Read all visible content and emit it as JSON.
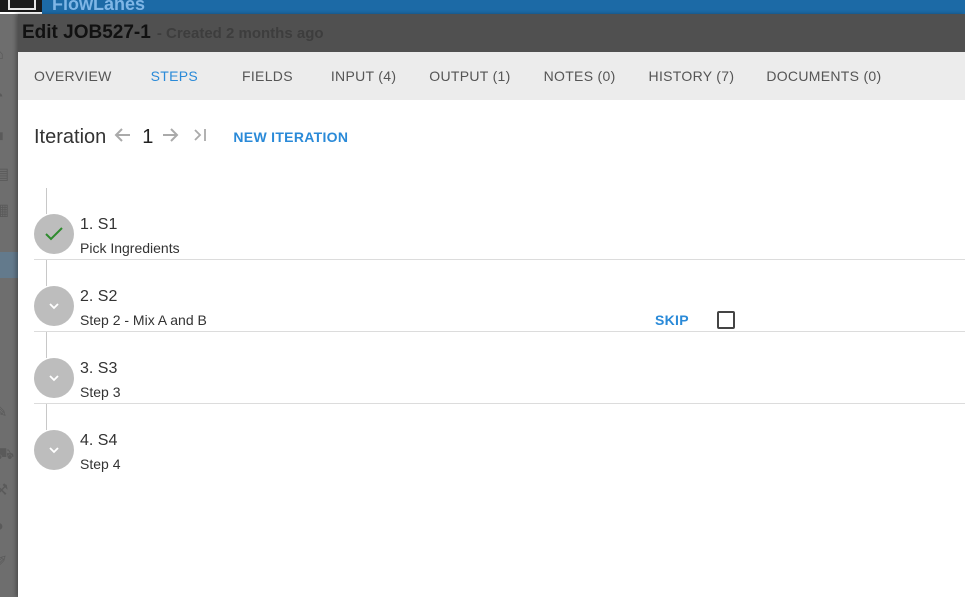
{
  "app": {
    "title": "FlowLanes"
  },
  "dialog": {
    "title": "Edit JOB527-1",
    "subtitle": "- Created 2 months ago"
  },
  "tabs": [
    {
      "label": "OVERVIEW",
      "active": false
    },
    {
      "label": "STEPS",
      "active": true
    },
    {
      "label": "FIELDS",
      "active": false
    },
    {
      "label": "INPUT (4)",
      "active": false
    },
    {
      "label": "OUTPUT (1)",
      "active": false
    },
    {
      "label": "NOTES (0)",
      "active": false
    },
    {
      "label": "HISTORY (7)",
      "active": false
    },
    {
      "label": "DOCUMENTS (0)",
      "active": false
    }
  ],
  "iteration": {
    "label": "Iteration",
    "prev_icon": "arrow-left-icon",
    "current": "1",
    "next_icon": "arrow-right-icon",
    "last_icon": "skip-to-last-icon",
    "new_label": "NEW ITERATION"
  },
  "steps": [
    {
      "title": "1. S1",
      "description": "Pick Ingredients",
      "status": "complete",
      "icon": "check-icon"
    },
    {
      "title": "2. S2",
      "description": "Step 2 - Mix A and B",
      "status": "pending",
      "icon": "chevron-down-icon",
      "skip_label": "SKIP",
      "checked": false
    },
    {
      "title": "3. S3",
      "description": "Step 3",
      "status": "pending",
      "icon": "chevron-down-icon"
    },
    {
      "title": "4. S4",
      "description": "Step 4",
      "status": "pending",
      "icon": "chevron-down-icon"
    }
  ],
  "colors": {
    "accent": "#2a8ad8",
    "check": "#2e8b2e",
    "circle": "#bdbdbd"
  }
}
